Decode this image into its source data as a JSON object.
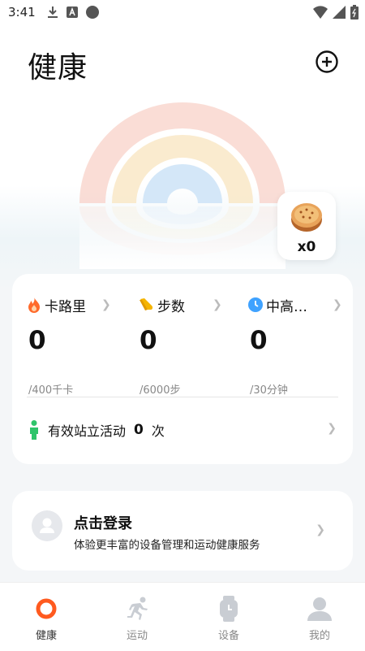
{
  "status_bar": {
    "time": "3:41"
  },
  "header": {
    "title": "健康"
  },
  "badge": {
    "count": "x0"
  },
  "metrics": [
    {
      "label": "卡路里",
      "value": "0",
      "goal": "/400千卡",
      "icon": "flame-icon",
      "color": "#ff6a2b"
    },
    {
      "label": "步数",
      "value": "0",
      "goal": "/6000步",
      "icon": "shoe-icon",
      "color": "#f5b400"
    },
    {
      "label": "中高…",
      "value": "0",
      "goal": "/30分钟",
      "icon": "clock-icon",
      "color": "#3fa2ff"
    }
  ],
  "stand": {
    "label": "有效站立活动",
    "count": "0",
    "unit": "次"
  },
  "login": {
    "title": "点击登录",
    "subtitle": "体验更丰富的设备管理和运动健康服务"
  },
  "nav": [
    {
      "label": "健康",
      "icon": "health-ring-icon",
      "active": true
    },
    {
      "label": "运动",
      "icon": "running-icon",
      "active": false
    },
    {
      "label": "设备",
      "icon": "watch-icon",
      "active": false
    },
    {
      "label": "我的",
      "icon": "profile-icon",
      "active": false
    }
  ],
  "colors": {
    "calorie": "#ff6a2b",
    "steps": "#f5b400",
    "active": "#3fa2ff",
    "stand": "#2ec46a",
    "accent": "#ff5a1f"
  }
}
